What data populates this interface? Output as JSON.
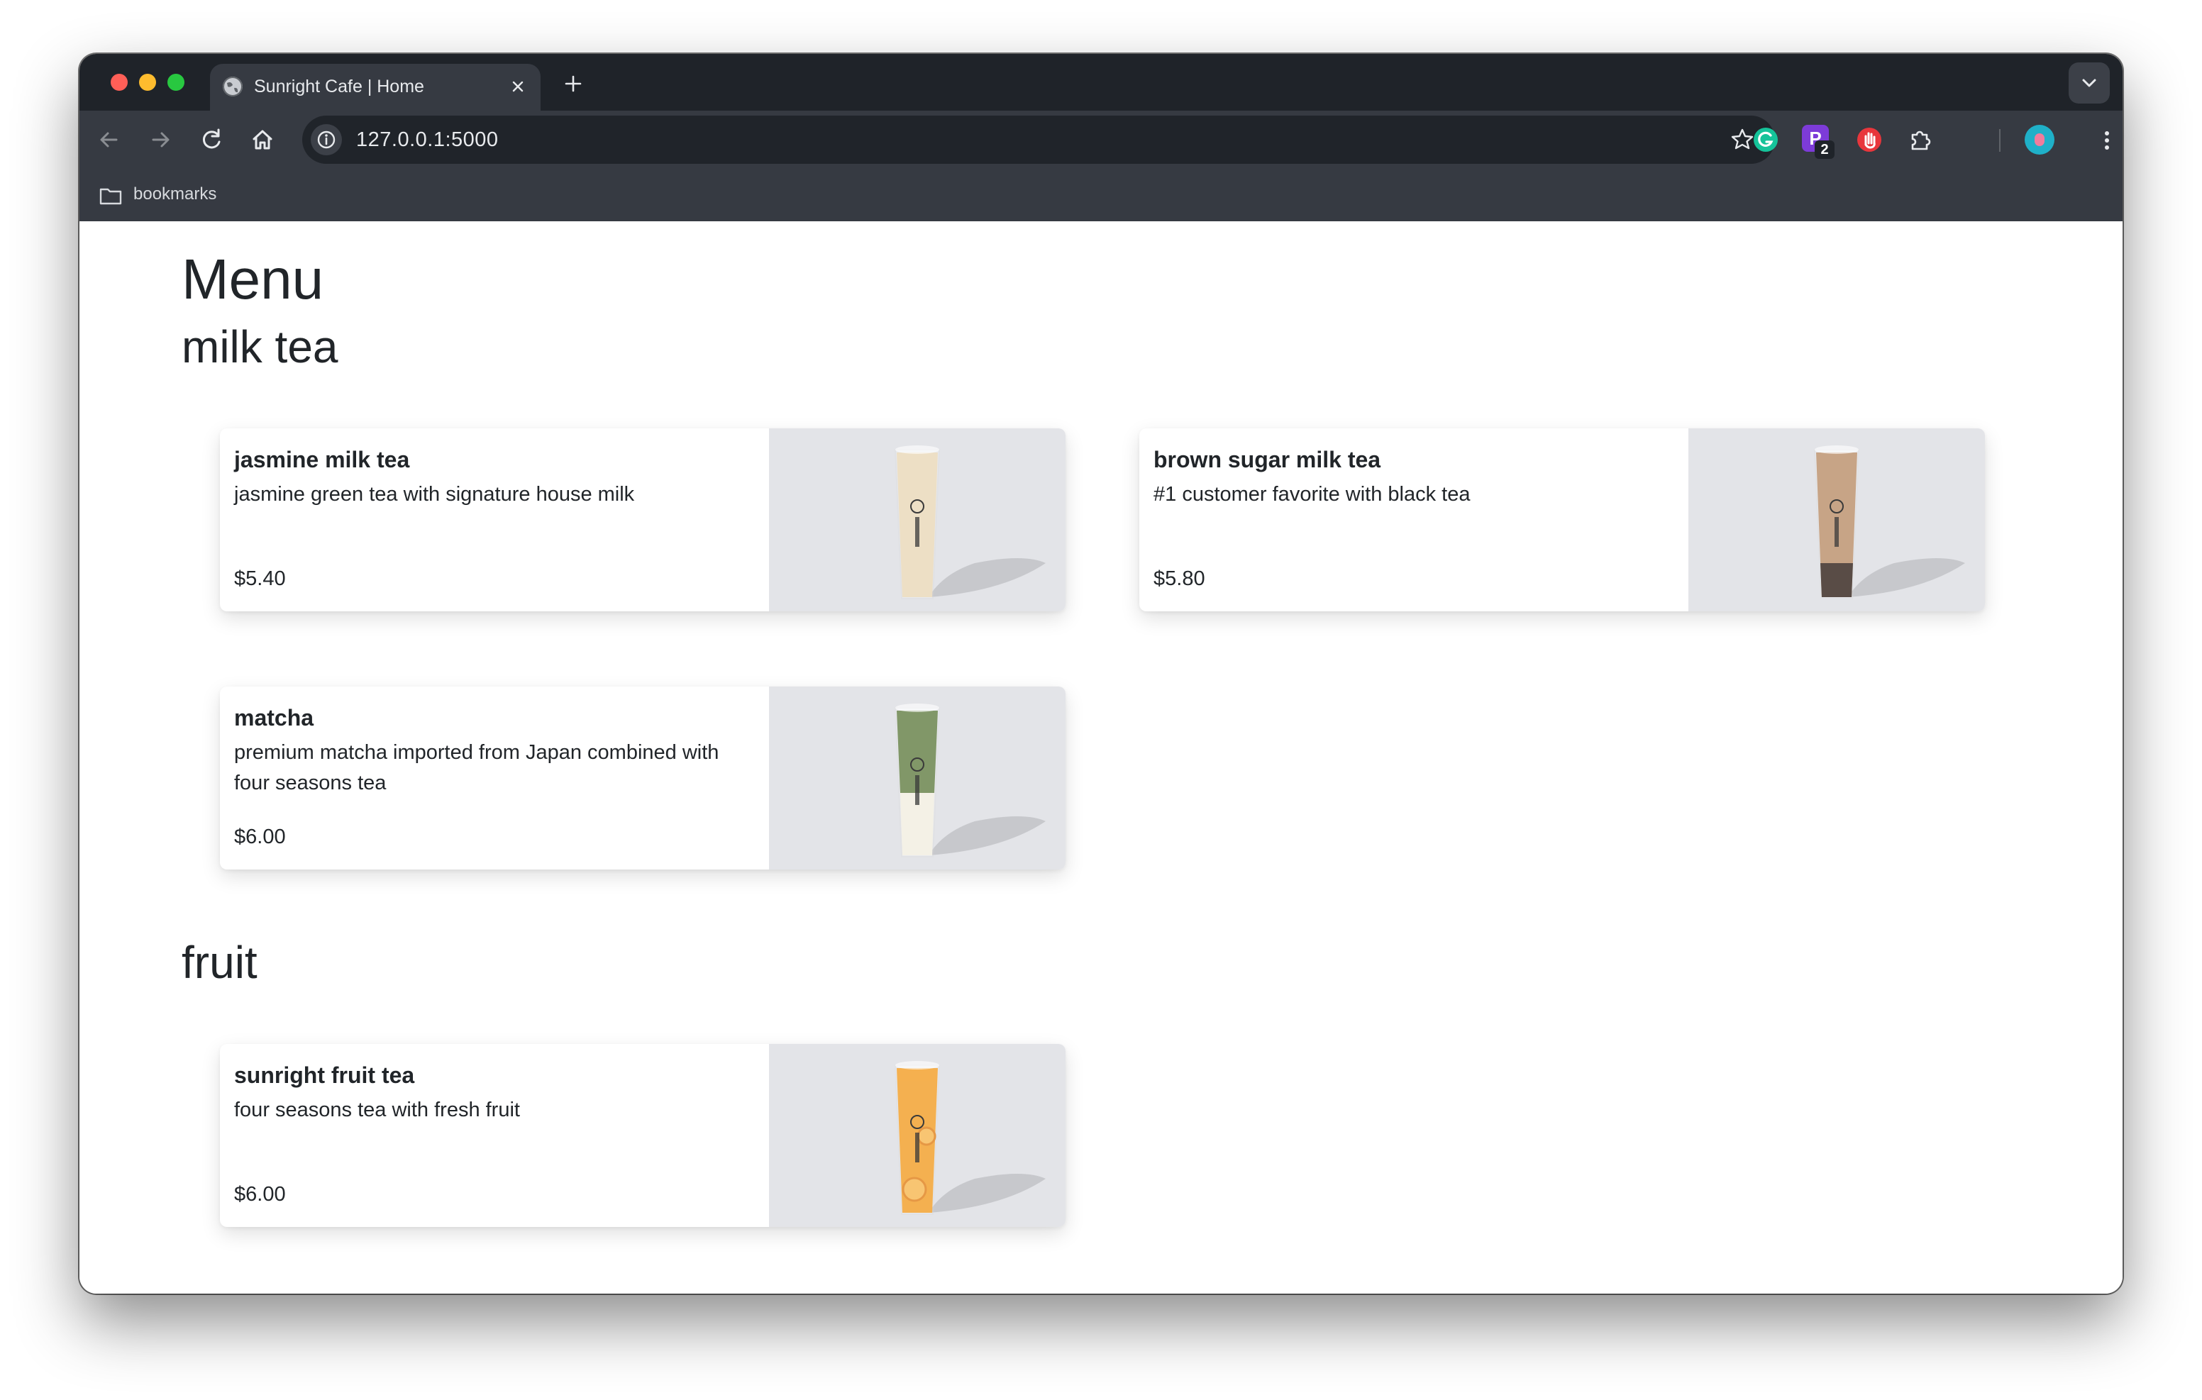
{
  "browser": {
    "tab_title": "Sunright Cafe | Home",
    "url": "127.0.0.1:5000",
    "bookmarks_label": "bookmarks",
    "extension_badge": "2",
    "extension_letter": "P",
    "traffic_light_colors": [
      "#ff5f57",
      "#febc2e",
      "#28c840"
    ]
  },
  "page": {
    "title": "Menu",
    "sections": [
      {
        "title": "milk tea",
        "items": [
          {
            "name": "jasmine milk tea",
            "description": "jasmine green tea with signature house milk",
            "price": "$5.40",
            "drink_color": "#e8d6b5"
          },
          {
            "name": "brown sugar milk tea",
            "description": "#1 customer favorite with black tea",
            "price": "$5.80",
            "drink_color": "#b88a64"
          },
          {
            "name": "matcha",
            "description": "premium matcha imported from Japan combined with four seasons tea",
            "price": "$6.00",
            "drink_color": "#5e7a3e"
          }
        ]
      },
      {
        "title": "fruit",
        "items": [
          {
            "name": "sunright fruit tea",
            "description": "four seasons tea with fresh fruit",
            "price": "$6.00",
            "drink_color": "#f29a1e"
          }
        ]
      }
    ]
  }
}
